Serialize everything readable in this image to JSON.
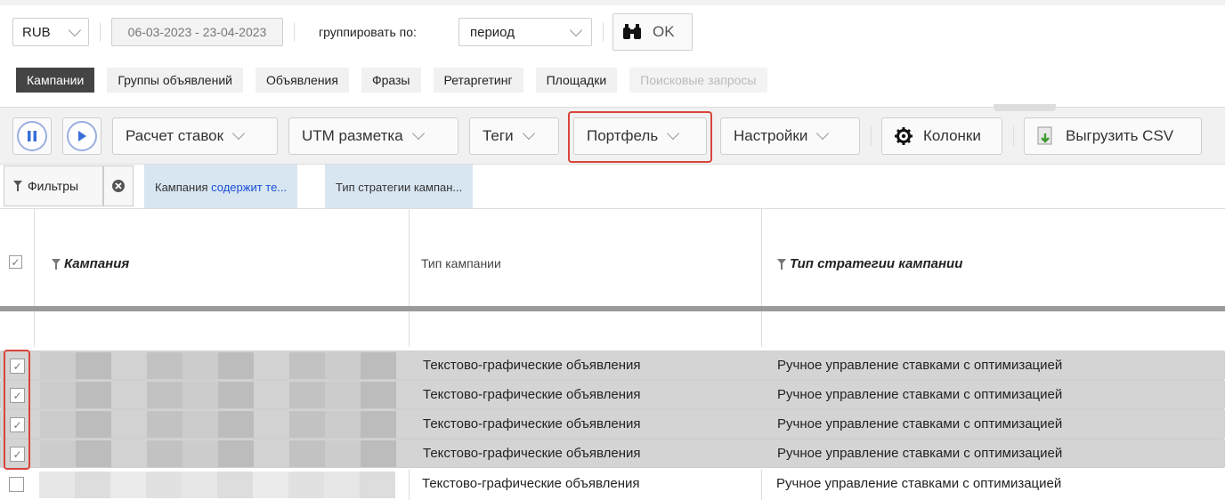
{
  "currency": {
    "value": "RUB"
  },
  "date_range": "06-03-2023 - 23-04-2023",
  "group_by": {
    "label": "группировать по:",
    "value": "период"
  },
  "ok_label": "OK",
  "tabs": [
    {
      "label": "Кампании",
      "state": "active"
    },
    {
      "label": "Группы объявлений",
      "state": "normal"
    },
    {
      "label": "Объявления",
      "state": "normal"
    },
    {
      "label": "Фразы",
      "state": "normal"
    },
    {
      "label": "Ретаргетинг",
      "state": "normal"
    },
    {
      "label": "Площадки",
      "state": "normal"
    },
    {
      "label": "Поисковые запросы",
      "state": "disabled"
    }
  ],
  "toolbar": {
    "bid_calc": "Расчет ставок",
    "utm": "UTM разметка",
    "tags": "Теги",
    "portfolio": "Портфель",
    "settings": "Настройки",
    "columns": "Колонки",
    "export_csv": "Выгрузить CSV"
  },
  "filters": {
    "label": "Фильтры",
    "chips": [
      {
        "prefix": "Кампания ",
        "link": "содержит те..."
      },
      {
        "prefix": "Тип стратегии кампан...",
        "link": ""
      }
    ]
  },
  "table": {
    "columns": {
      "campaign": "Кампания",
      "campaign_type": "Тип кампании",
      "strategy_type": "Тип стратегии кампании"
    },
    "rows": [
      {
        "checked": true,
        "type": "Текстово-графические объявления",
        "strategy": "Ручное управление ставками с оптимизацией"
      },
      {
        "checked": true,
        "type": "Текстово-графические объявления",
        "strategy": "Ручное управление ставками с оптимизацией"
      },
      {
        "checked": true,
        "type": "Текстово-графические объявления",
        "strategy": "Ручное управление ставками с оптимизацией"
      },
      {
        "checked": true,
        "type": "Текстово-графические объявления",
        "strategy": "Ручное управление ставками с оптимизацией"
      },
      {
        "checked": false,
        "type": "Текстово-графические объявления",
        "strategy": "Ручное управление ставками с оптимизацией"
      }
    ]
  },
  "colors": {
    "highlight": "#d9443a",
    "selected_row": "#d4d4d4",
    "chip": "#d8e6f2",
    "active_tab": "#444444"
  }
}
